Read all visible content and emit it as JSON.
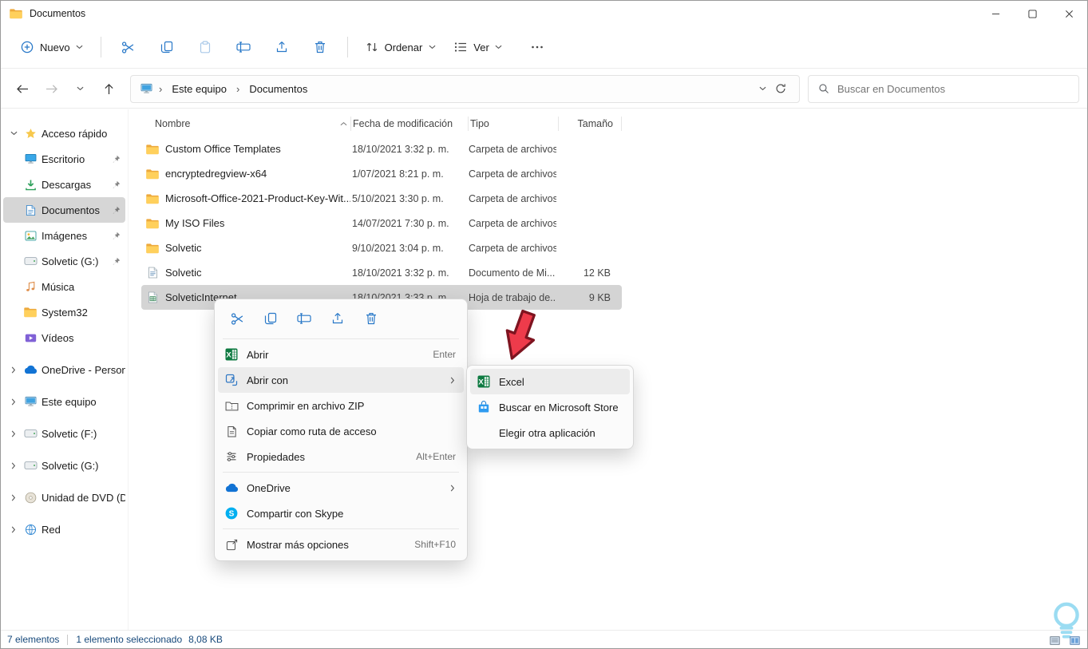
{
  "window": {
    "title": "Documentos"
  },
  "toolbar": {
    "new_button": {
      "label": "Nuevo",
      "icon": "plus-circle"
    },
    "actions": [
      {
        "icon": "cut"
      },
      {
        "icon": "copy"
      },
      {
        "icon": "paste",
        "disabled": true
      },
      {
        "icon": "rename"
      },
      {
        "icon": "share"
      },
      {
        "icon": "delete"
      }
    ],
    "sort_button": {
      "label": "Ordenar",
      "icon": "sort"
    },
    "view_button": {
      "label": "Ver",
      "icon": "view"
    },
    "more_button": {
      "icon": "ellipsis"
    }
  },
  "navbar": {
    "breadcrumb_root": "Este equipo",
    "breadcrumb_current": "Documentos",
    "search_placeholder": "Buscar en Documentos"
  },
  "sidebar": {
    "items": [
      {
        "label": "Acceso rápido",
        "icon": "star",
        "chevron": "down",
        "top_level": true
      },
      {
        "label": "Escritorio",
        "icon": "desktop",
        "pinned": true
      },
      {
        "label": "Descargas",
        "icon": "downloads",
        "pinned": true
      },
      {
        "label": "Documentos",
        "icon": "documents",
        "pinned": true,
        "selected": true
      },
      {
        "label": "Imágenes",
        "icon": "pictures",
        "pinned": true
      },
      {
        "label": "Solvetic (G:)",
        "icon": "drive",
        "pinned": true
      },
      {
        "label": "Música",
        "icon": "music"
      },
      {
        "label": "System32",
        "icon": "folder"
      },
      {
        "label": "Vídeos",
        "icon": "videos"
      },
      {
        "label": "OneDrive - Personal",
        "icon": "onedrive",
        "chevron": "right",
        "top_level": true
      },
      {
        "label": "Este equipo",
        "icon": "pc",
        "chevron": "right",
        "top_level": true
      },
      {
        "label": "Solvetic (F:)",
        "icon": "drive",
        "chevron": "right",
        "top_level": true
      },
      {
        "label": "Solvetic (G:)",
        "icon": "drive",
        "chevron": "right",
        "top_level": true
      },
      {
        "label": "Unidad de DVD (D:)",
        "icon": "dvd",
        "chevron": "right",
        "top_level": true
      },
      {
        "label": "Red",
        "icon": "network",
        "chevron": "right",
        "top_level": true
      }
    ]
  },
  "filelist": {
    "columns": [
      {
        "label": "Nombre"
      },
      {
        "label": "Fecha de modificación"
      },
      {
        "label": "Tipo"
      },
      {
        "label": "Tamaño"
      }
    ],
    "rows": [
      {
        "name": "Custom Office Templates",
        "icon": "folder",
        "date": "18/10/2021 3:32 p. m.",
        "type": "Carpeta de archivos",
        "size": ""
      },
      {
        "name": "encryptedregview-x64",
        "icon": "folder",
        "date": "1/07/2021 8:21 p. m.",
        "type": "Carpeta de archivos",
        "size": ""
      },
      {
        "name": "Microsoft-Office-2021-Product-Key-Wit...",
        "icon": "folder",
        "date": "5/10/2021 3:30 p. m.",
        "type": "Carpeta de archivos",
        "size": ""
      },
      {
        "name": "My ISO Files",
        "icon": "folder",
        "date": "14/07/2021 7:30 p. m.",
        "type": "Carpeta de archivos",
        "size": ""
      },
      {
        "name": "Solvetic",
        "icon": "folder",
        "date": "9/10/2021 3:04 p. m.",
        "type": "Carpeta de archivos",
        "size": ""
      },
      {
        "name": "Solvetic",
        "icon": "doc",
        "date": "18/10/2021 3:32 p. m.",
        "type": "Documento de Mi...",
        "size": "12 KB"
      },
      {
        "name": "SolveticInternet",
        "icon": "excel-file",
        "date": "18/10/2021 3:33 p. m.",
        "type": "Hoja de trabajo de...",
        "size": "9 KB",
        "selected": true
      }
    ]
  },
  "context_menu": {
    "quick_actions": [
      {
        "icon": "cut"
      },
      {
        "icon": "copy"
      },
      {
        "icon": "rename"
      },
      {
        "icon": "share"
      },
      {
        "icon": "delete"
      }
    ],
    "items": [
      {
        "label": "Abrir",
        "icon": "excel",
        "shortcut": "Enter"
      },
      {
        "label": "Abrir con",
        "icon": "open-with",
        "submenu": true,
        "highlighted": true
      },
      {
        "label": "Comprimir en archivo ZIP",
        "icon": "zip"
      },
      {
        "label": "Copiar como ruta de acceso",
        "icon": "copy-path"
      },
      {
        "label": "Propiedades",
        "icon": "properties",
        "shortcut": "Alt+Enter",
        "separator_after": true
      },
      {
        "label": "OneDrive",
        "icon": "onedrive",
        "submenu": true
      },
      {
        "label": "Compartir con Skype",
        "icon": "skype",
        "separator_after": true
      },
      {
        "label": "Mostrar más opciones",
        "icon": "more-options",
        "shortcut": "Shift+F10"
      }
    ]
  },
  "open_with_submenu": {
    "items": [
      {
        "label": "Excel",
        "icon": "excel",
        "highlighted": true
      },
      {
        "label": "Buscar en Microsoft Store",
        "icon": "store"
      },
      {
        "label": "Elegir otra aplicación",
        "icon": "none"
      }
    ]
  },
  "statusbar": {
    "item_count": "7 elementos",
    "selection": "1 elemento seleccionado",
    "selection_size": "8,08 KB"
  },
  "colors": {
    "accent_blue": "#2878c8",
    "selection_gray": "#d4d4d4",
    "folder_yellow": "#ffd05c",
    "excel_green": "#0e7a41",
    "arrow_red": "#ee3b4b",
    "status_text": "#17497b"
  }
}
